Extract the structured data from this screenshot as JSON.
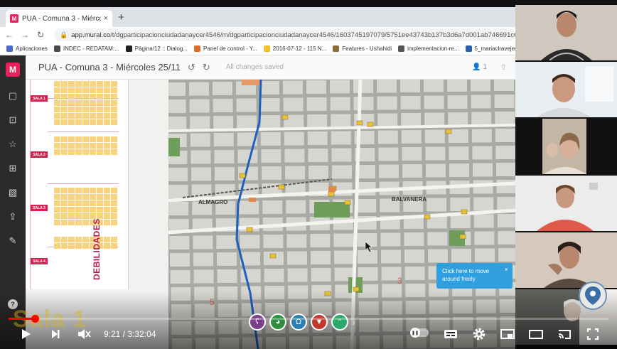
{
  "browser": {
    "tab_title": "PUA - Comuna 3 - Miércoles 25/",
    "tab_close": "×",
    "new_tab": "+",
    "url_host": "app.mural.co",
    "url_path": "/t/dgparticipacionciudadanaycer4546/m/dgparticipacionciudadanaycer4546/1603745197079/5751ee43743b137b3d6a7d001ab746691c65cbe7",
    "bookmarks": [
      {
        "label": "Aplicaciones",
        "color": "#4a6bd4"
      },
      {
        "label": "INDEC - REDATAM:...",
        "color": "#4a4a4a"
      },
      {
        "label": "Página/12 :: Dialog...",
        "color": "#222222"
      },
      {
        "label": "Panel de control - Y...",
        "color": "#e06b2c"
      },
      {
        "label": "2016-07-12 - 115 N...",
        "color": "#f2c12e"
      },
      {
        "label": "Features - Ushahidi",
        "color": "#8a6d3b"
      },
      {
        "label": "implementacion-re...",
        "color": "#555555"
      },
      {
        "label": "5_mariaclravejer",
        "color": "#2a5db0"
      }
    ]
  },
  "mural": {
    "logo": "M",
    "title": "PUA - Comuna 3 - Miércoles 25/11",
    "save_status": "All changes saved",
    "collaborators": "1",
    "board": {
      "salas": [
        "SALA 1",
        "SALA 2",
        "SALA 3",
        "SALA 4"
      ],
      "section_title": "DEBILIDADES"
    },
    "map": {
      "labels": [
        "ALMAGRO",
        "BALVANERA"
      ],
      "zones": [
        "3",
        "5"
      ]
    },
    "tooltip": {
      "text": "Click here to move around freely",
      "close": "×"
    },
    "help": "?"
  },
  "video": {
    "overlay_title": "Sala 1",
    "current_time": "9:21",
    "duration": "3:32:04",
    "progress": 0.044,
    "buffered": 0.05,
    "colors": {
      "played": "#ff0000",
      "accent": "#e9225d",
      "tooltip": "#2f9fe0"
    },
    "participant_avatars": [
      {
        "icon": "bear-icon",
        "color": "#7b3f8a"
      },
      {
        "icon": "panda-icon",
        "color": "#2f8f3f"
      },
      {
        "icon": "owl-icon",
        "color": "#2a7fb0"
      },
      {
        "icon": "fox-icon",
        "color": "#c0392b"
      },
      {
        "icon": "monkey-icon",
        "color": "#2aa86a"
      }
    ],
    "avatars_more": "›"
  }
}
